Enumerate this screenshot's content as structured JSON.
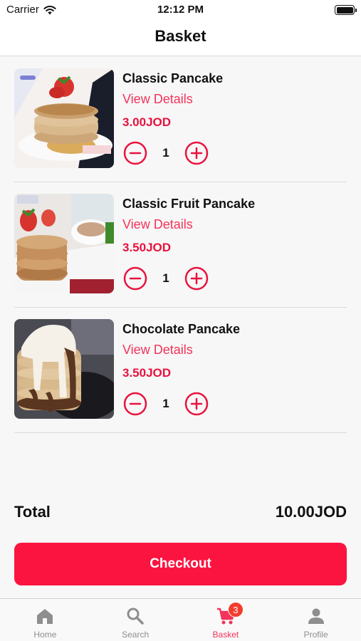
{
  "status_bar": {
    "carrier": "Carrier",
    "time": "12:12 PM"
  },
  "header": {
    "title": "Basket"
  },
  "basket": {
    "items": [
      {
        "name": "Classic Pancake",
        "details_label": "View Details",
        "price": "3.00JOD",
        "quantity": "1"
      },
      {
        "name": "Classic Fruit Pancake",
        "details_label": "View Details",
        "price": "3.50JOD",
        "quantity": "1"
      },
      {
        "name": "Chocolate Pancake",
        "details_label": "View Details",
        "price": "3.50JOD",
        "quantity": "1"
      }
    ]
  },
  "summary": {
    "total_label": "Total",
    "total_value": "10.00JOD"
  },
  "checkout": {
    "label": "Checkout"
  },
  "tab_bar": {
    "tabs": [
      {
        "label": "Home",
        "icon": "home-icon",
        "active": false
      },
      {
        "label": "Search",
        "icon": "search-icon",
        "active": false
      },
      {
        "label": "Basket",
        "icon": "cart-icon",
        "active": true,
        "badge": "3"
      },
      {
        "label": "Profile",
        "icon": "person-icon",
        "active": false
      }
    ]
  },
  "colors": {
    "accent": "#f2335b",
    "button": "#fc1440",
    "badge": "#f23d2e",
    "inactive_tab": "#8e8e8e"
  }
}
